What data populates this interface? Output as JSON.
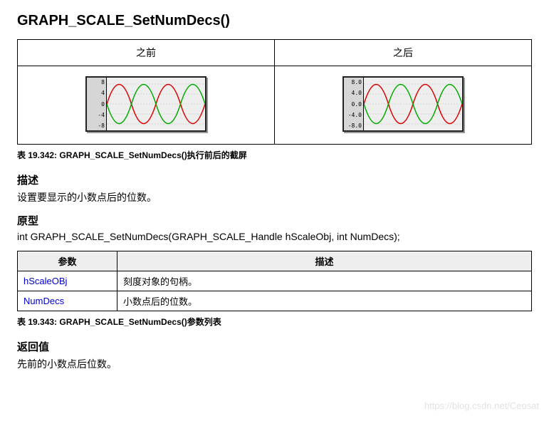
{
  "title": "GRAPH_SCALE_SetNumDecs()",
  "compare": {
    "before_label": "之前",
    "after_label": "之后",
    "before_ticks": [
      "8",
      "4",
      "0",
      "-4",
      "-8"
    ],
    "after_ticks": [
      "8.0",
      "4.0",
      "0.0",
      "-4.0",
      "-8.0"
    ]
  },
  "caption1": "表 19.342: GRAPH_SCALE_SetNumDecs()执行前后的截屏",
  "desc_h": "描述",
  "desc_t": "设置要显示的小数点后的位数。",
  "proto_h": "原型",
  "proto_t": "int GRAPH_SCALE_SetNumDecs(GRAPH_SCALE_Handle hScaleObj, int NumDecs);",
  "param_header": {
    "c1": "参数",
    "c2": "描述"
  },
  "params": [
    {
      "name": "hScaleOBj",
      "desc": "刻度对象的句柄。"
    },
    {
      "name": "NumDecs",
      "desc": "小数点后的位数。"
    }
  ],
  "caption2": "表 19.343: GRAPH_SCALE_SetNumDecs()参数列表",
  "ret_h": "返回值",
  "ret_t": "先前的小数点后位数。",
  "watermark": "https://blog.csdn.net/Ceosat"
}
